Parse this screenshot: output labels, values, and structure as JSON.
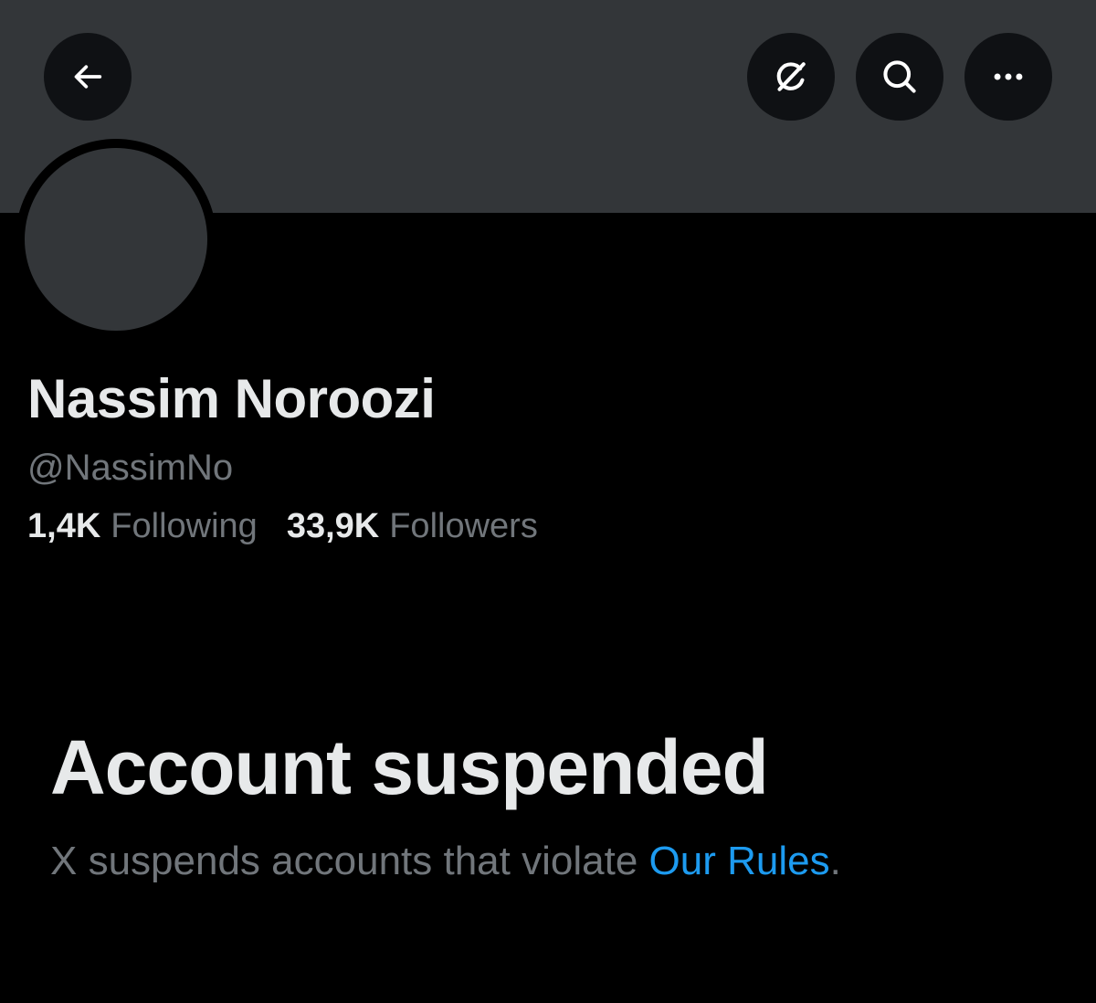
{
  "header": {
    "back_icon": "arrow-left-icon",
    "grok_icon": "grok-icon",
    "search_icon": "search-icon",
    "more_icon": "more-horizontal-icon"
  },
  "profile": {
    "display_name": "Nassim Noroozi",
    "handle": "@NassimNo",
    "following_count": "1,4K",
    "following_label": "Following",
    "followers_count": "33,9K",
    "followers_label": "Followers"
  },
  "suspension": {
    "title": "Account suspended",
    "message": "X suspends accounts that violate ",
    "link_text": "Our Rules",
    "trailing": "."
  },
  "colors": {
    "background": "#000000",
    "banner": "#333639",
    "primary_text": "#e7e9ea",
    "secondary_text": "#71767b",
    "link": "#1d9bf0"
  }
}
